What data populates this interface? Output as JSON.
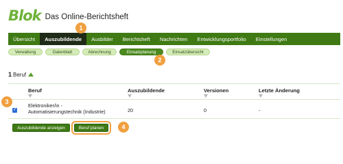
{
  "app": {
    "logo_text": "Blok",
    "title": "Das Online-Berichtsheft"
  },
  "main_nav": {
    "items": [
      {
        "label": "Übersicht",
        "active": false
      },
      {
        "label": "Auszubildende",
        "active": true
      },
      {
        "label": "Ausbilder",
        "active": false
      },
      {
        "label": "Berichtsheft",
        "active": false
      },
      {
        "label": "Nachrichten",
        "active": false
      },
      {
        "label": "Entwicklungsportfolio",
        "active": false
      },
      {
        "label": "Einstellungen",
        "active": false
      }
    ]
  },
  "sub_nav": {
    "items": [
      {
        "label": "Verwaltung",
        "active": false
      },
      {
        "label": "Datenblatt",
        "active": false
      },
      {
        "label": "Abrechnung",
        "active": false
      },
      {
        "label": "Einsatzplanung",
        "active": true
      },
      {
        "label": "Einsatzübersicht",
        "active": false
      }
    ]
  },
  "result_count": {
    "number": "1",
    "label": "Beruf"
  },
  "table": {
    "columns": [
      "Beruf",
      "Auszubildende",
      "Versionen",
      "Letzte Änderung"
    ],
    "rows": [
      {
        "checked": true,
        "beruf_line1": "Elektroniker/in -",
        "beruf_line2": "Automatisierungstechnik (Industrie)",
        "auszubildende": "20",
        "versionen": "0",
        "letzte_aenderung": "-"
      }
    ]
  },
  "actions": {
    "show_trainees": "Auszubildende anzeigen",
    "plan_profession": "Beruf planen"
  },
  "markers": [
    "1",
    "2",
    "3",
    "4"
  ],
  "colors": {
    "brand_green": "#6fb23a",
    "nav_green": "#3f7a14",
    "nav_active": "#1f2a17",
    "pill_bg": "#d5ebb8",
    "marker_orange": "#f0a040"
  }
}
